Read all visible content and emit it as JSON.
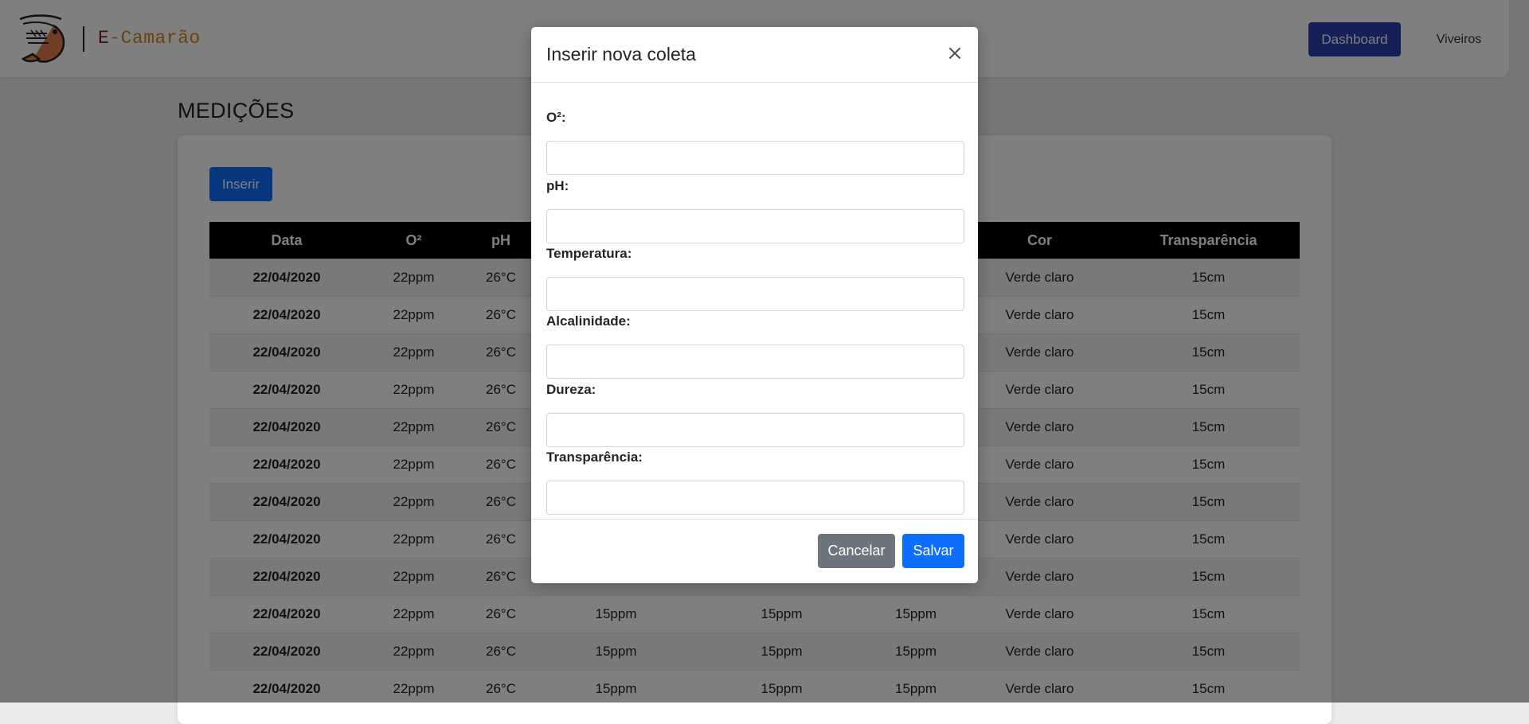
{
  "navbar": {
    "brand_prefix": "E",
    "brand_rest": "-Camarão",
    "logo_icon": "shrimp-icon",
    "dashboard_label": "Dashboard",
    "viveiros_label": "Viveiros",
    "colors": {
      "dashboard_button": "#2d3fb0",
      "brand_e": "#7a1f1f",
      "brand_rest": "#d0891d"
    }
  },
  "page": {
    "title": "MEDIÇÕES",
    "insert_button_label": "Inserir"
  },
  "table": {
    "headers": [
      "Data",
      "O²",
      "pH",
      "",
      "",
      "",
      "Cor",
      "Transparência"
    ],
    "rows": [
      [
        "22/04/2020",
        "22ppm",
        "26°C",
        "",
        "",
        "",
        "Verde claro",
        "15cm"
      ],
      [
        "22/04/2020",
        "22ppm",
        "26°C",
        "",
        "",
        "",
        "Verde claro",
        "15cm"
      ],
      [
        "22/04/2020",
        "22ppm",
        "26°C",
        "",
        "",
        "",
        "Verde claro",
        "15cm"
      ],
      [
        "22/04/2020",
        "22ppm",
        "26°C",
        "",
        "",
        "",
        "Verde claro",
        "15cm"
      ],
      [
        "22/04/2020",
        "22ppm",
        "26°C",
        "",
        "",
        "",
        "Verde claro",
        "15cm"
      ],
      [
        "22/04/2020",
        "22ppm",
        "26°C",
        "",
        "",
        "",
        "Verde claro",
        "15cm"
      ],
      [
        "22/04/2020",
        "22ppm",
        "26°C",
        "",
        "",
        "",
        "Verde claro",
        "15cm"
      ],
      [
        "22/04/2020",
        "22ppm",
        "26°C",
        "",
        "",
        "",
        "Verde claro",
        "15cm"
      ],
      [
        "22/04/2020",
        "22ppm",
        "26°C",
        "",
        "",
        "",
        "Verde claro",
        "15cm"
      ],
      [
        "22/04/2020",
        "22ppm",
        "26°C",
        "15ppm",
        "15ppm",
        "15ppm",
        "Verde claro",
        "15cm"
      ],
      [
        "22/04/2020",
        "22ppm",
        "26°C",
        "15ppm",
        "15ppm",
        "15ppm",
        "Verde claro",
        "15cm"
      ],
      [
        "22/04/2020",
        "22ppm",
        "26°C",
        "15ppm",
        "15ppm",
        "15ppm",
        "Verde claro",
        "15cm"
      ]
    ]
  },
  "modal": {
    "title": "Inserir nova coleta",
    "close_symbol": "×",
    "fields": [
      {
        "label": "O²:",
        "value": ""
      },
      {
        "label": "pH:",
        "value": ""
      },
      {
        "label": "Temperatura:",
        "value": ""
      },
      {
        "label": "Alcalinidade:",
        "value": ""
      },
      {
        "label": "Dureza:",
        "value": ""
      },
      {
        "label": "Transparência:",
        "value": ""
      }
    ],
    "cancel_label": "Cancelar",
    "save_label": "Salvar",
    "colors": {
      "cancel_button": "#6c757d",
      "save_button": "#0d6efd"
    }
  }
}
